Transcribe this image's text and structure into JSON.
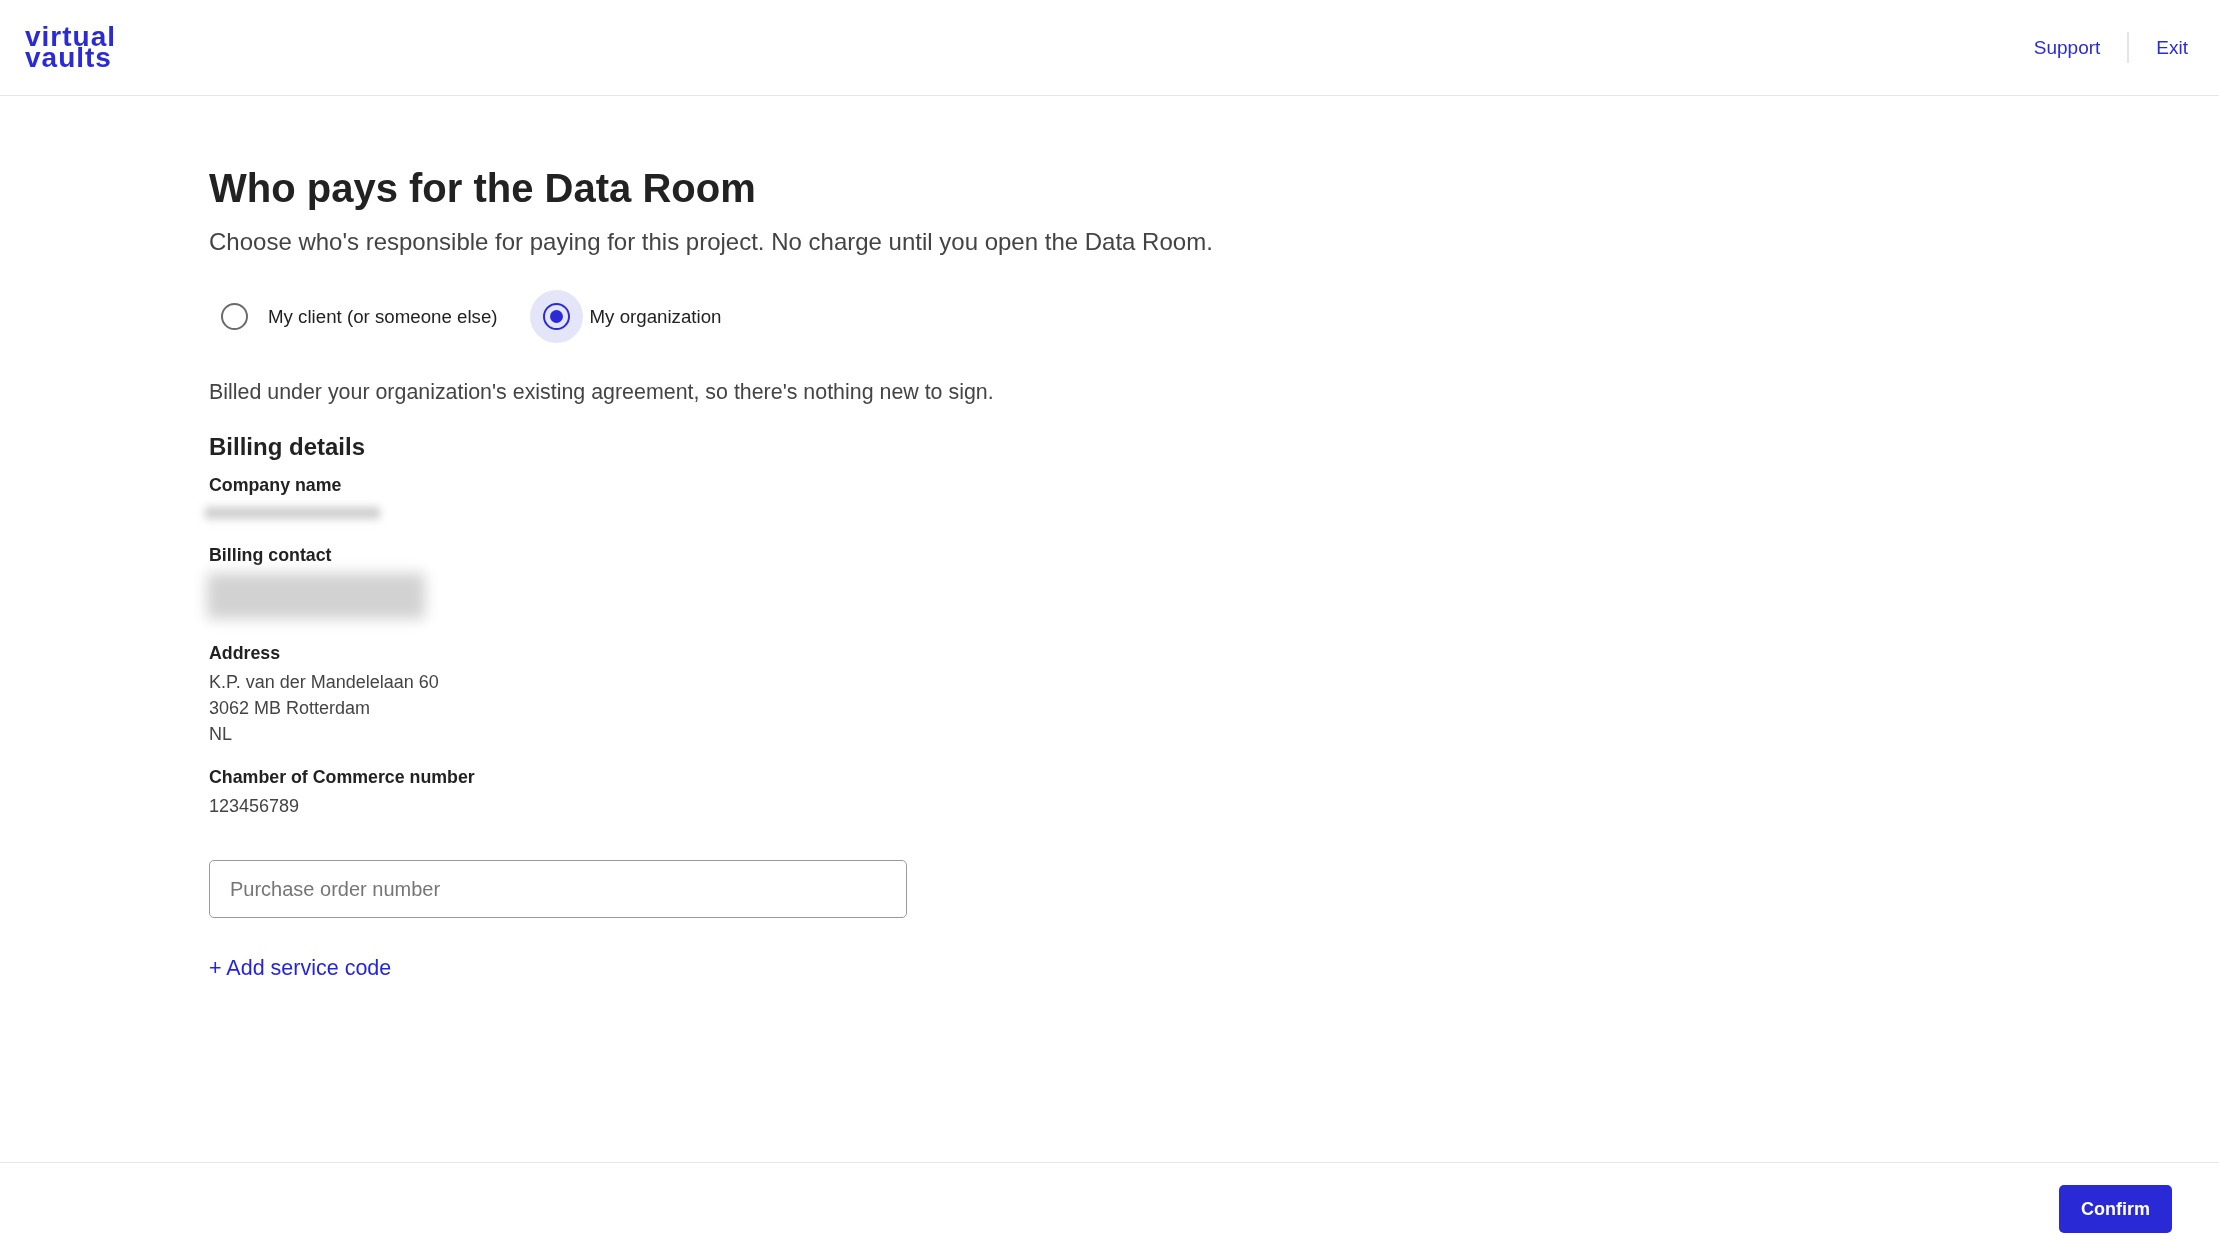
{
  "header": {
    "logo": [
      "virtual",
      "vaults"
    ],
    "links": [
      "Support",
      "Exit"
    ]
  },
  "title": "Who pays for the Data Room",
  "subtitle": "Choose who's responsible for paying for this project. No charge until you open the Data Room.",
  "payer_options": [
    {
      "label": "My client (or someone else)",
      "selected": false
    },
    {
      "label": "My organization",
      "selected": true
    }
  ],
  "note": "Billed under your organization's existing agreement, so there's nothing new to sign.",
  "billing_details": {
    "heading": "Billing details",
    "fields": [
      {
        "label": "Company name",
        "kind": "redacted_line"
      },
      {
        "label": "Billing contact",
        "kind": "redacted_block"
      },
      {
        "label": "Address",
        "kind": "lines",
        "lines": [
          "K.P. van der Mandelelaan 60",
          "3062 MB Rotterdam",
          "NL"
        ]
      },
      {
        "label": "Chamber of Commerce number",
        "kind": "lines",
        "lines": [
          "123456789"
        ]
      }
    ]
  },
  "purchase_order": {
    "placeholder": "Purchase order number"
  },
  "add_link": "+ Add service code",
  "footer": {
    "button": "Confirm"
  }
}
